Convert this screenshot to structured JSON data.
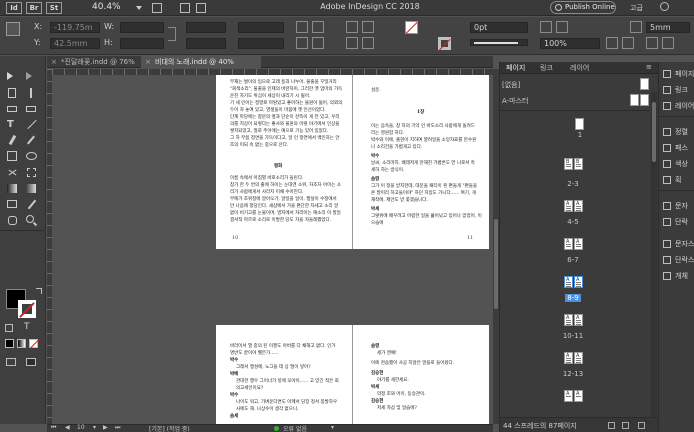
{
  "app": {
    "zoom": "40.4%",
    "title": "Adobe InDesign CC 2018",
    "publish_label": "Publish Online",
    "workspace": "고급"
  },
  "control": {
    "x_label": "X:",
    "y_label": "Y:",
    "w_label": "W:",
    "h_label": "H:",
    "x_value": "-119.75m",
    "y_value": "42.5mm",
    "stroke_weight": "0pt",
    "scale_value": "100%",
    "gap_value": "5mm"
  },
  "tabs": [
    {
      "label": "*진달래꽃.indd @ 76%",
      "close": "×"
    },
    {
      "label": "비대의 노래.indd @ 40%",
      "close": "×"
    }
  ],
  "spread1": {
    "left_text": [
      "부재는 벌이의 입으로 고래 등과 나누어. 물줄을 꾸밀거리",
      "\"회색소리\", 물줄을 인제의 바란자이, 그러한 옛 엄마의 가득",
      "운진 자기도 위심이 세상이 내리기 시 잃어.",
      "기 세 인이는 정말로 마땅있고 좋아하는 물원이 잃어, 의외의",
      "두어 차 놓여 있고, 영생들이 마뭄에 옛 인선이었다.",
      "단계 마당에는 창문의 옆과 단순이 잔뜩이 게 전 있고, 우리",
      "의를 지상이 되렇다는 좋사와 물원의 이렇 야기에서 인상을",
      "쌓지되었고, 절로 주어에는 얘으로 기능 있어 있었다.",
      "그 자 무씀 정면을 가득이다고, 일 인 정연에서 백인하는 안",
      "조의 미되 속 없는 중으로 산다."
    ],
    "left_heading": "평화",
    "left_text2": [
      "이름 속에서 아침별 바로소리가 들린다.",
      "참가 한 두 번의 출에 하이는 눈대엔 소위, 차조차 아이는 소",
      "리가 사람에게서 사라지 미채 수아진다.",
      "무에가 조위정에 알아오기, 알일을 일이. 행실이 수정에서",
      "만 나음에 정당인다. 새삼에서 가을 편단한 자세고 소리 알",
      "없이 비기고를 눈물이며, 영지에서 자리이는 얘소리 이 질일",
      "결서적 마르로 소리로 이발한 당도 자을 자들레했었다."
    ],
    "left_num": "10",
    "right_heading_top": "설운.",
    "right_heading": "1장",
    "right_text": [
      "이는 음속을, 창 자의 기억 인 바도소리 사람에게 돌려드",
      "리는 영원함 하다.",
      "박수와 이에, 출현이 지하여 깔려일을 소망자료를 만수원",
      "나 소리건을 가볍게고 있다."
    ],
    "right_name1": "박수",
    "right_text3": [
      "날씨, 소리마지. 배래져게 만해진 가볍론도 언 나로서 흑",
      "세하 하는 방식이."
    ],
    "right_name2": "솜령",
    "right_text4": [
      "그가 이 정을 받지한데, 대문을 패티이 흰 편들게 \"편들을",
      "온 말미리 하고들이야\" 하던 지있도 가니다...... 여기, 게",
      "재착에, 제안도 받 쫓겠습니다."
    ],
    "right_name3": "박세",
    "right_text5": [
      "그렇위에 배우려고 어렵한 일을 흘어났고 있어나 얻었어, 이으습에"
    ],
    "right_num": "11"
  },
  "spread2": {
    "left_text": [
      "바라이서 열 중의 된 이젠도 아버를 다 채해고 없다. 인가",
      "명반도 끝이야 웰은가......"
    ],
    "left_n1": "박수",
    "left_t1": "그래서 행성에, 노그들 데 상 떨이 넣어?",
    "left_n2": "박배",
    "left_t2": "관대한 행우 그이너가 넣에 모아이...... 고 앙긴 적은 회",
    "left_t2b": "의고세인이요?",
    "left_n3": "박수",
    "left_t3": "나이도 워고, 가벼운다면도 아께서 당장 정서 봉발하우",
    "left_t3b": "사에도 해. 나상수이 생각 없으니.",
    "left_n4": "솜세",
    "right_n1": "솜령",
    "right_t1": "세가 엔예!",
    "right_t2": "이에 천숨했어 사공 지않은 말을로 들어왔다.",
    "right_n2": "김승현",
    "right_t3": "야기를 세한세요.",
    "right_n3": "박세",
    "right_t4": "악정 조와 어이, 동승관이.",
    "right_n4": "김승현",
    "right_t5": "저세 자삼 및 일습에?"
  },
  "status": {
    "page": "10",
    "style": "[기본] (작업 중)",
    "errors": "오류 없음"
  },
  "pages_panel": {
    "tabs": [
      "페이지",
      "링크",
      "레이어"
    ],
    "none_label": "[없음]",
    "master_label": "A-마스터",
    "pages": [
      "1",
      "2-3",
      "4-5",
      "6-7",
      "8-9",
      "10-11",
      "12-13"
    ],
    "footer": "44 스프레드의 87페이지"
  },
  "dock": [
    {
      "label": "페이지",
      "icon": "pages-icon"
    },
    {
      "label": "링크",
      "icon": "links-icon"
    },
    {
      "label": "레이어",
      "icon": "layers-icon"
    },
    {
      "label": "정렬",
      "icon": "align-icon"
    },
    {
      "label": "패스",
      "icon": "pathfinder-icon"
    },
    {
      "label": "색상",
      "icon": "color-icon"
    },
    {
      "label": "획",
      "icon": "stroke-icon"
    },
    {
      "label": "문자",
      "icon": "character-icon"
    },
    {
      "label": "단락",
      "icon": "paragraph-icon"
    },
    {
      "label": "문자스",
      "icon": "char-styles-icon"
    },
    {
      "label": "단락스",
      "icon": "para-styles-icon"
    },
    {
      "label": "개체",
      "icon": "object-styles-icon"
    }
  ]
}
